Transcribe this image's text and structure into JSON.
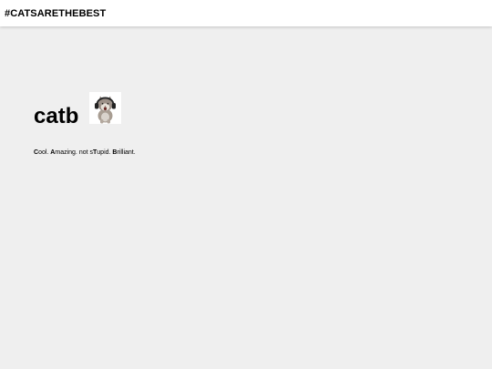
{
  "header": {
    "brand": "#CATSARETHEBEST"
  },
  "main": {
    "title": "catb",
    "image_alt": "cat wearing headphones",
    "tagline": [
      {
        "bold": "C",
        "rest": "ool. "
      },
      {
        "bold": "A",
        "rest": "mazing. not s"
      },
      {
        "bold": "T",
        "rest": "upid. "
      },
      {
        "bold": "B",
        "rest": "rilliant."
      }
    ]
  },
  "colors": {
    "page_background": "#efefef",
    "header_background": "#ffffff",
    "text": "#000000"
  }
}
